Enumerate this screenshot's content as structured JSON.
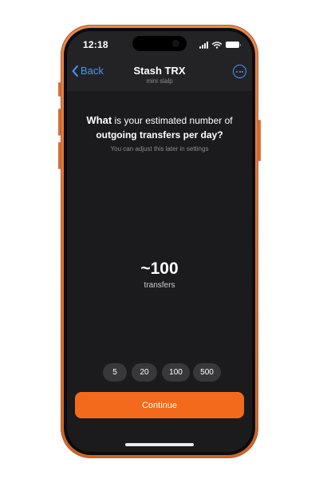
{
  "status_bar": {
    "time": "12:18",
    "icons": [
      "cellular-signal-icon",
      "wifi-icon",
      "battery-icon"
    ]
  },
  "nav": {
    "back_label": "Back",
    "title": "Stash TRX",
    "subtitle": "mini slalp",
    "back_icon": "chevron-left-icon",
    "more_icon": "ellipsis-circle-icon"
  },
  "question": {
    "word_what": "What",
    "rest_line1": "is your estimated number of",
    "line2": "outgoing transfers per day?",
    "hint": "You can adjust this later in settings"
  },
  "estimate": {
    "value": "~100",
    "unit": "transfers"
  },
  "presets": [
    {
      "label": "5"
    },
    {
      "label": "20"
    },
    {
      "label": "100"
    },
    {
      "label": "500"
    }
  ],
  "continue_label": "Continue",
  "colors": {
    "frame": "#e07d44",
    "screen_bg": "#1b1b1d",
    "header_bg": "#232326",
    "accent_blue": "#4a96ff",
    "chip_bg": "#38383c",
    "primary_button": "#f36a1d",
    "secondary_text": "#8d8d92"
  }
}
